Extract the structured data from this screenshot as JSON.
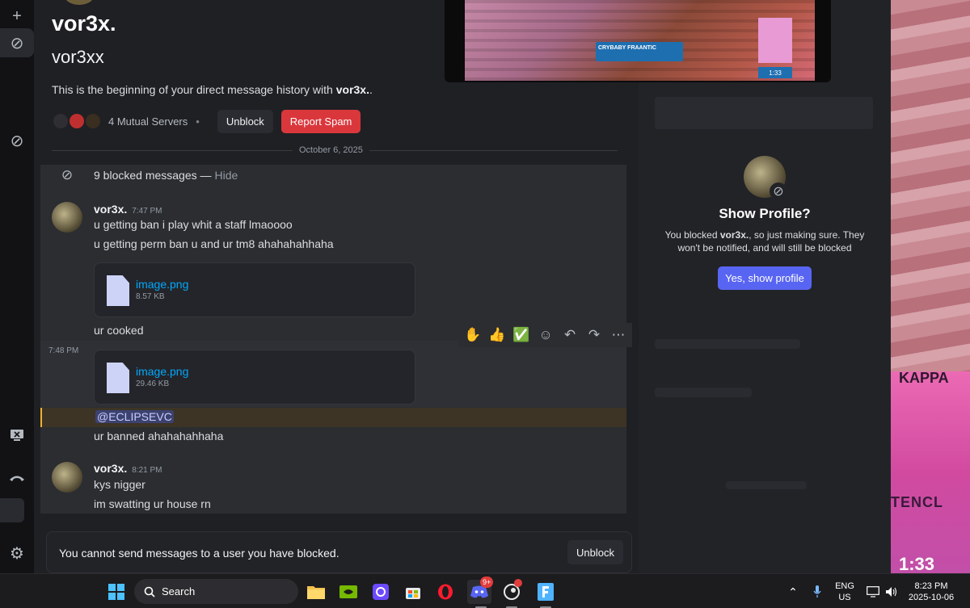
{
  "profile": {
    "display_name": "vor3x.",
    "username": "vor3xx",
    "intro_prefix": "This is the beginning of your direct message history with ",
    "intro_name": "vor3x.",
    "intro_suffix": ".",
    "mutual_servers": "4 Mutual Servers",
    "separator": "•",
    "unblock_label": "Unblock",
    "report_label": "Report Spam"
  },
  "date_divider": "October 6, 2025",
  "blocked_messages": {
    "text": "9 blocked messages — ",
    "hide_label": "Hide"
  },
  "messages": [
    {
      "author": "vor3x.",
      "time": "7:47 PM",
      "lines": [
        "u getting ban i play whit a staff lmaoooo",
        "u getting perm ban u and ur tm8 ahahahahhaha"
      ],
      "attachment": {
        "name": "image.png",
        "size": "8.57 KB"
      },
      "after": "ur cooked"
    },
    {
      "side_time": "7:48 PM",
      "attachment": {
        "name": "image.png",
        "size": "29.46 KB"
      },
      "mention": "@ECLIPSEVC",
      "text": "ur banned ahahahahhaha"
    },
    {
      "author": "vor3x.",
      "time": "8:21 PM",
      "lines": [
        "kys nigger",
        "im swatting ur house rn"
      ]
    }
  ],
  "message_actions": {
    "emojis": [
      "✋",
      "👍",
      "✅"
    ],
    "icons": [
      "add-reaction-icon",
      "reply-icon",
      "forward-icon",
      "more-icon"
    ]
  },
  "composer": {
    "notice": "You cannot send messages to a user you have blocked.",
    "unblock_label": "Unblock"
  },
  "show_profile": {
    "title": "Show Profile?",
    "text_prefix": "You blocked ",
    "text_name": "vor3x.",
    "text_suffix": ", so just making sure. They won't be notified, and will still be blocked",
    "button": "Yes, show profile"
  },
  "video_preview": {
    "player_name": "CRYBABY FRAANTIC",
    "timer": "1:33"
  },
  "wallpaper": {
    "word1": "KAPPA",
    "word2": "TENCL",
    "timer": "1:33"
  },
  "taskbar": {
    "search_label": "Search",
    "discord_badge": "9+",
    "lang_top": "ENG",
    "lang_bottom": "US",
    "time": "8:23 PM",
    "date": "2025-10-06"
  },
  "colors": {
    "accent": "#5865f2",
    "danger": "#da373c",
    "link": "#00a8fc",
    "mention_bg": "#3c4270"
  }
}
